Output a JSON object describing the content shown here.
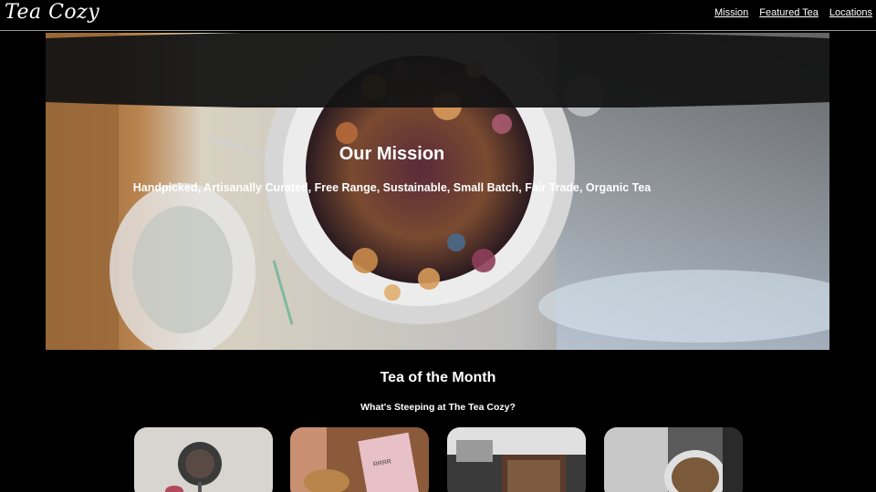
{
  "header": {
    "logo": "Tea Cozy",
    "nav": [
      {
        "label": "Mission"
      },
      {
        "label": "Featured Tea"
      },
      {
        "label": "Locations"
      }
    ]
  },
  "hero": {
    "title": "Our Mission",
    "text": "Handpicked, Artisanally Curated, Free Range, Sustainable, Small Batch, Fair Trade, Organic Tea"
  },
  "featured": {
    "title": "Tea of the Month",
    "subtitle": "What's Steeping at The Tea Cozy?"
  },
  "cards": [
    {
      "name": "tea-card-1"
    },
    {
      "name": "tea-card-2"
    },
    {
      "name": "tea-card-3"
    },
    {
      "name": "tea-card-4"
    }
  ]
}
